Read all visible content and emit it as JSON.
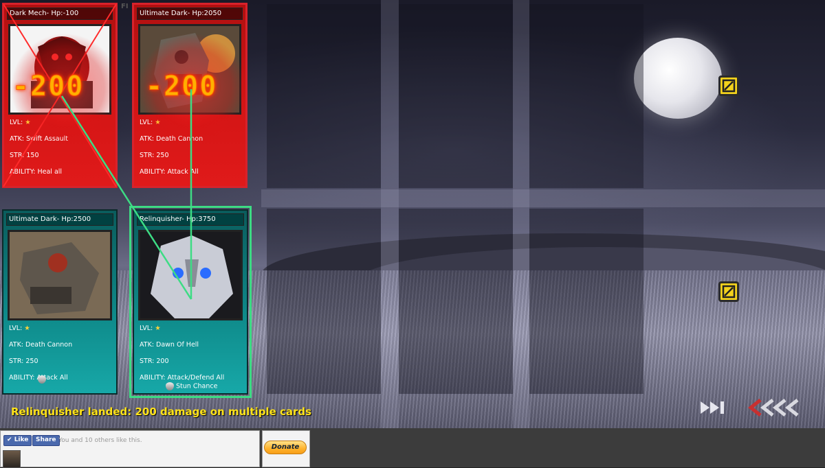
{
  "board": {
    "enemy_cards": [
      {
        "header": "Dark Mech- Hp:-100",
        "damage": "-200",
        "level_label": "LVL:",
        "level_stars": 1,
        "atk": "ATK: Swift Assault",
        "str": "STR: 150",
        "ability": "ABILITY: Heal all",
        "defeated": true
      },
      {
        "header": "Ultimate Dark- Hp:2050",
        "damage": "-200",
        "level_label": "LVL:",
        "level_stars": 1,
        "atk": "ATK: Death Cannon",
        "str": "STR: 250",
        "ability": "ABILITY: Attack All",
        "defeated": false
      }
    ],
    "player_cards": [
      {
        "header": "Ultimate Dark- Hp:2500",
        "level_label": "LVL:",
        "level_stars": 1,
        "atk": "ATK: Death Cannon",
        "str": "STR: 250",
        "ability": "ABILITY: Attack All",
        "selected": false
      },
      {
        "header": "Relinquisher- Hp:3750",
        "level_label": "LVL:",
        "level_stars": 1,
        "atk": "ATK: Dawn Of Hell",
        "str": "STR: 200",
        "ability": "ABILITY: Attack/Defend All",
        "ability_extra": "Stun Chance",
        "selected": true
      }
    ],
    "battle_log": "Relinquisher landed: 200 damage on multiple cards",
    "colors": {
      "enemy_card": "#d31515",
      "player_card": "#0f8c8c",
      "selected_outline": "#3ddc84",
      "attack_line": "#3ddc84",
      "log_text": "#ffe31a",
      "null_button": "#f3d21c"
    },
    "icons": [
      "null-slot-icon",
      "fast-forward-icon",
      "back-arrows-icon",
      "shield-icon",
      "star-icon"
    ]
  },
  "footer": {
    "like_label": "Like",
    "share_label": "Share",
    "social_text": "You and 10 others like this.",
    "donate_label": "Donate"
  }
}
